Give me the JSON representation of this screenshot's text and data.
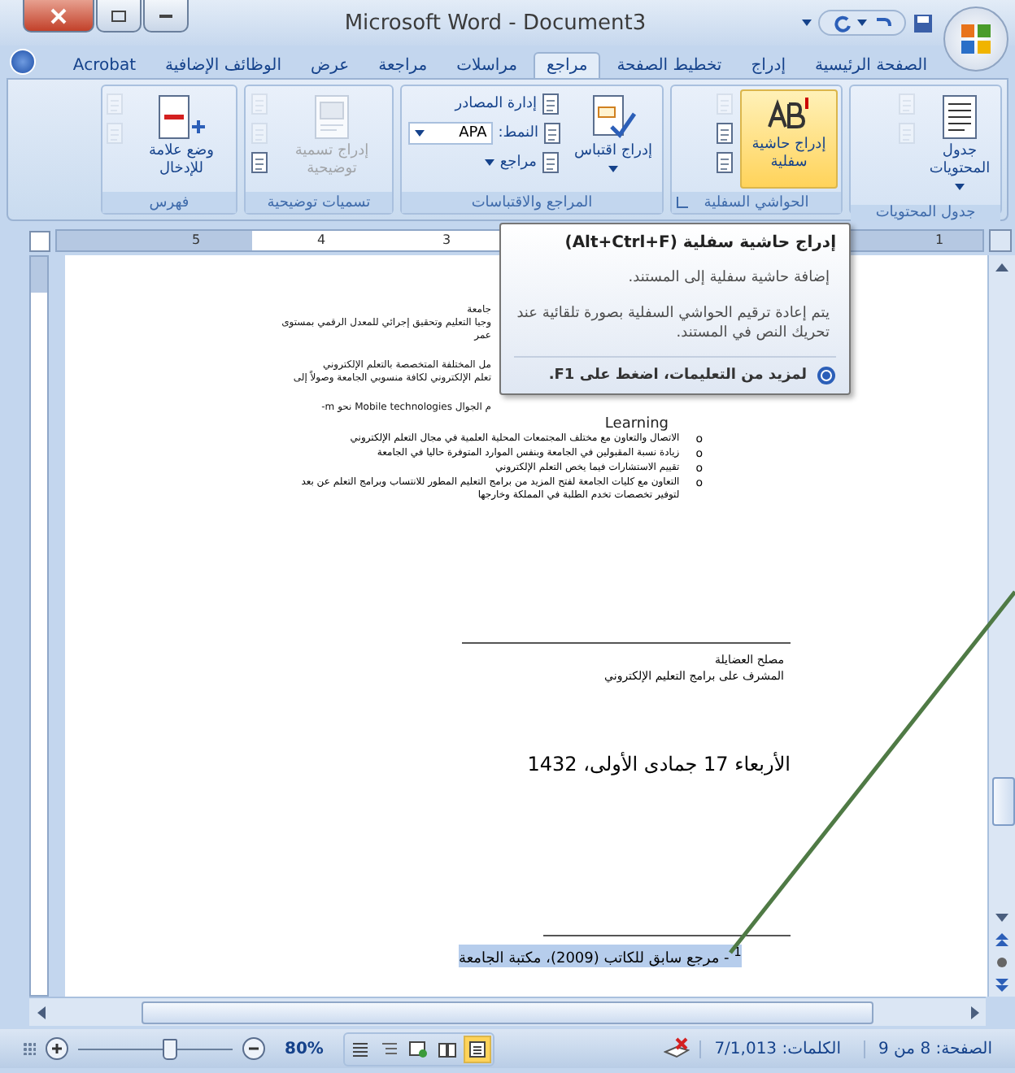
{
  "title_bar": {
    "title": "Microsoft Word - Document3"
  },
  "tabs": [
    {
      "label": "الصفحة الرئيسية",
      "selected": false
    },
    {
      "label": "إدراج",
      "selected": false
    },
    {
      "label": "تخطيط الصفحة",
      "selected": false
    },
    {
      "label": "مراجع",
      "selected": true
    },
    {
      "label": "مراسلات",
      "selected": false
    },
    {
      "label": "مراجعة",
      "selected": false
    },
    {
      "label": "عرض",
      "selected": false
    },
    {
      "label": "الوظائف الإضافية",
      "selected": false
    },
    {
      "label": "Acrobat",
      "selected": false
    }
  ],
  "ribbon": {
    "groups": [
      {
        "kind": "toc",
        "label": "جدول المحتويات",
        "large_button": {
          "label": "جدول المحتويات",
          "dropdown": true,
          "highlighted": false,
          "disabled": false
        },
        "small_items": [
          {
            "kind": "icon",
            "disabled": true
          },
          {
            "kind": "icon",
            "disabled": true
          }
        ]
      },
      {
        "kind": "footnote",
        "label": "الحواشي السفلية",
        "launcher": true,
        "large_button": {
          "label": "إدراج حاشية سفلية",
          "highlighted": true,
          "disabled": false
        },
        "small_items": [
          {
            "kind": "icon",
            "disabled": true
          },
          {
            "kind": "icon",
            "disabled": false
          },
          {
            "kind": "icon",
            "disabled": false
          }
        ]
      },
      {
        "kind": "citation",
        "label": "المراجع والاقتباسات",
        "large_button": {
          "label": "إدراج اقتباس",
          "dropdown": true,
          "highlighted": false,
          "disabled": false
        },
        "small_items": [
          {
            "kind": "text",
            "label": "إدارة المصادر",
            "disabled": false
          },
          {
            "kind": "select",
            "label": "النمط:",
            "value": "APA",
            "disabled": false
          },
          {
            "kind": "text",
            "label": "مراجع",
            "dropdown": true,
            "disabled": false
          }
        ]
      },
      {
        "kind": "caption",
        "label": "تسميات توضيحية",
        "large_button": {
          "label": "إدراج تسمية توضيحية",
          "highlighted": false,
          "disabled": true
        },
        "small_items": [
          {
            "kind": "icon",
            "disabled": true
          },
          {
            "kind": "icon",
            "disabled": true
          },
          {
            "kind": "icon",
            "disabled": false
          }
        ]
      },
      {
        "kind": "index",
        "label": "فهرس",
        "large_button": {
          "label": "وضع علامة للإدخال",
          "highlighted": false,
          "disabled": false
        },
        "small_items": [
          {
            "kind": "icon",
            "disabled": true
          },
          {
            "kind": "icon",
            "disabled": true
          }
        ]
      }
    ]
  },
  "ruler": {
    "numbers": [
      "1",
      "3",
      "4",
      "5"
    ]
  },
  "tooltip": {
    "title": "إدراج حاشية سفلية (Alt+Ctrl+F)",
    "lines": [
      "إضافة حاشية سفلية إلى المستند.",
      "يتم إعادة ترقيم الحواشي السفلية بصورة تلقائية عند تحريك النص في المستند."
    ],
    "help": "لمزيد من التعليمات، اضغط على F1."
  },
  "document": {
    "paragraphs": [
      [
        "جامعة",
        "وجيا التعليم وتحقيق إجرائي للمعدل الرقمي بمستوى",
        "عمر"
      ],
      [
        "مل المختلفة المتخصصة بالتعلم الإلكتروني",
        "تعلم الإلكتروني لكافة منسوبي الجامعة وصولاً إلى"
      ],
      [
        "م الجوال Mobile technologies نحو m-"
      ]
    ],
    "learning": "Learning",
    "bullets": [
      {
        "marker": "o",
        "text": "الاتصال والتعاون مع مختلف المجتمعات المحلية العلمية في مجال التعلم الإلكتروني"
      },
      {
        "marker": "o",
        "text": "زيادة نسبة المقبولين في الجامعة وبنفس الموارد المتوفرة حاليا في الجامعة"
      },
      {
        "marker": "o",
        "text": "تقييم الاستشارات فيما يخص التعلم الإلكتروني"
      },
      {
        "marker": "o",
        "text": "التعاون مع كليات الجامعة لفتح المزيد من برامج التعليم المطور للانتساب وبرامج التعلم عن بعد لتوفير تخصصات تخدم الطلبة في المملكة وخارجها"
      }
    ],
    "signature": [
      "مصلح العضايلة",
      "المشرف على برامج التعليم الإلكتروني"
    ],
    "date": "الأربعاء 17 جمادى الأولى، 1432",
    "footnote": {
      "text": "$^{1}$ - مرجع سابق للكاتب (2009)، مكتبة الجامعة",
      "selected": true
    }
  },
  "status_bar": {
    "page": "الصفحة: 8 من 9",
    "words": "الكلمات: 7/1,013",
    "zoom": "80%",
    "views": [
      {
        "kind": "print",
        "selected": true
      },
      {
        "kind": "reading",
        "selected": false
      },
      {
        "kind": "web",
        "selected": false
      },
      {
        "kind": "outline",
        "selected": false
      },
      {
        "kind": "draft",
        "selected": false
      }
    ]
  }
}
